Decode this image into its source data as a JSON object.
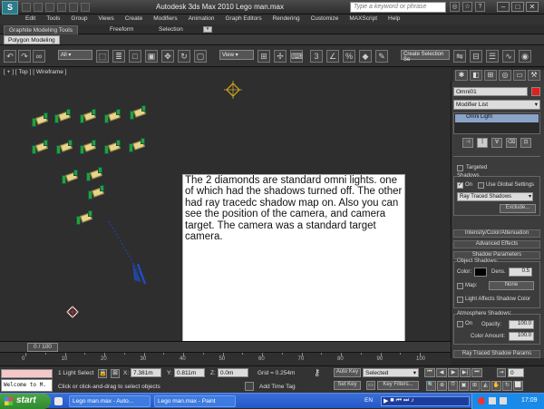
{
  "app": {
    "title": "Autodesk 3ds Max  2010     Lego man.max",
    "help_search_placeholder": "Type a keyword or phrase",
    "logo_glyph": "S"
  },
  "menu": [
    "Edit",
    "Tools",
    "Group",
    "Views",
    "Create",
    "Modifiers",
    "Animation",
    "Graph Editors",
    "Rendering",
    "Customize",
    "MAXScript",
    "Help"
  ],
  "ribbon": {
    "tabs": [
      "Graphite Modeling Tools",
      "Freeform",
      "Selection"
    ],
    "panel_button": "Polygon Modeling"
  },
  "toolbar": {
    "selection_filter": "All",
    "view_dropdown": "View",
    "named_selection": "Create Selection Se"
  },
  "viewport": {
    "label": "[ + ] [ Top ] [ Wireframe ]",
    "note": "The 2 diamonds are standard omni lights. one of which had the shadows turned off.  The other had ray tracedc shadow map on.  Also you can see the position of the camera, and camera target. The camera was a standard target camera."
  },
  "command_panel": {
    "object_name": "Omni01",
    "modifier_list": "Modifier List",
    "stack_item": "Omni Light",
    "targeted_label": "Targeted",
    "shadows_header": "Shadows",
    "on_label": "On",
    "use_global_label": "Use Global Settings",
    "shadow_type": "Ray Traced Shadows",
    "exclude_button": "Exclude...",
    "rollouts": {
      "intensity": "Intensity/Color/Attenuation",
      "advanced": "Advanced Effects",
      "shadow_params": "Shadow Parameters",
      "raytraced": "Ray Traced Shadow Params"
    },
    "object_shadows_label": "Object Shadows:",
    "color_label": "Color:",
    "dens_label": "Dens.",
    "dens_value": "0.5",
    "map_label": "Map:",
    "map_value": "None",
    "light_affects_label": "Light Affects Shadow Color",
    "atmos_header": "Atmosphere Shadows:",
    "atmos_on_label": "On",
    "opacity_label": "Opacity:",
    "opacity_value": "100.0",
    "color_amount_label": "Color Amount:",
    "color_amount_value": "100.0"
  },
  "timeline": {
    "slider_label": "0 / 100",
    "ticks": [
      "0",
      "10",
      "20",
      "30",
      "40",
      "50",
      "60",
      "70",
      "80",
      "90",
      "100"
    ]
  },
  "status": {
    "maxscript": "Welcome to M.",
    "selection_count": "1 Light Select",
    "x_label": "X:",
    "x_value": "7.381m",
    "y_label": "Y:",
    "y_value": "0.811m",
    "z_label": "Z:",
    "z_value": "0.0m",
    "grid": "Grid = 0.254m",
    "prompt": "Click or click-and-drag to select objects",
    "add_time_tag": "Add Time Tag",
    "auto_key": "Auto Key",
    "set_key": "Set Key",
    "selected_dropdown": "Selected",
    "key_filters": "Key Filters...",
    "frame_value": "0"
  },
  "taskbar": {
    "start": "start",
    "tasks": [
      "Lego man.max - Auto...",
      "Lego man.max - Paint"
    ],
    "language": "EN",
    "clock": "17:09"
  },
  "colors": {
    "accent_green": "#2aa02a",
    "brick_yellow": "#e8d48a",
    "light_diamond": "#d4a820",
    "taskbar_blue": "#2458c9"
  }
}
